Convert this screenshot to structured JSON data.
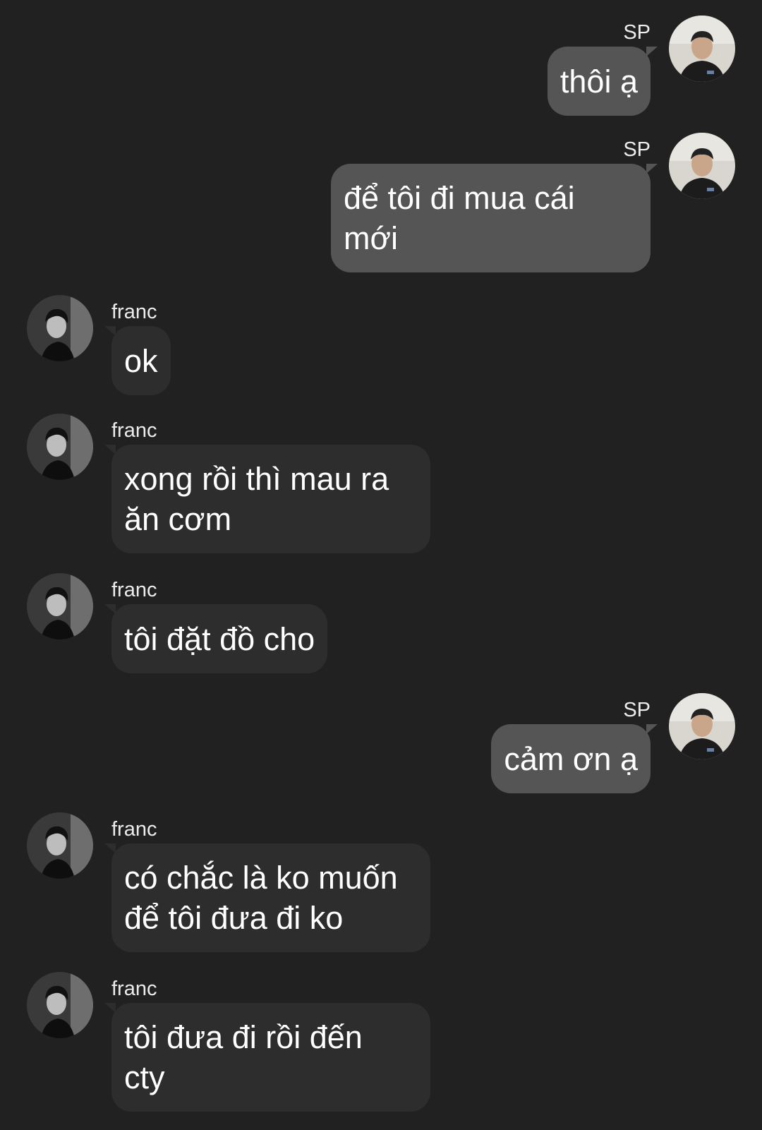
{
  "conversation": {
    "messages": [
      {
        "sender": "SP",
        "direction": "out",
        "lines": [
          "thôi ạ"
        ]
      },
      {
        "sender": "SP",
        "direction": "out",
        "lines": [
          "để tôi đi mua cái",
          "mới"
        ]
      },
      {
        "sender": "franc",
        "direction": "in",
        "lines": [
          "ok"
        ]
      },
      {
        "sender": "franc",
        "direction": "in",
        "lines": [
          "xong rồi thì mau ra",
          "ăn cơm"
        ]
      },
      {
        "sender": "franc",
        "direction": "in",
        "lines": [
          "tôi đặt đồ cho"
        ]
      },
      {
        "sender": "SP",
        "direction": "out",
        "lines": [
          "cảm ơn ạ"
        ]
      },
      {
        "sender": "franc",
        "direction": "in",
        "lines": [
          "có chắc là ko muốn",
          "để tôi đưa đi ko"
        ]
      },
      {
        "sender": "franc",
        "direction": "in",
        "lines": [
          "tôi đưa đi rồi đến",
          "cty"
        ]
      }
    ]
  },
  "colors": {
    "background": "#212121",
    "incoming_bubble": "#2d2d2d",
    "outgoing_bubble": "#555555",
    "text": "#ffffff"
  },
  "icons": {
    "incoming_avatar": "franc-avatar-icon",
    "outgoing_avatar": "sp-avatar-icon"
  }
}
